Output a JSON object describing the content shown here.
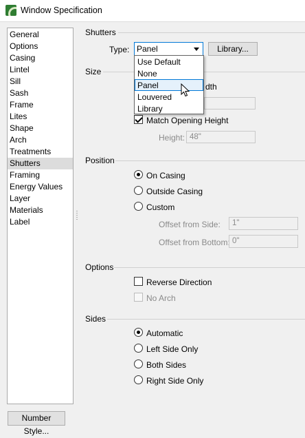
{
  "window": {
    "title": "Window Specification"
  },
  "nav": {
    "items": [
      "General",
      "Options",
      "Casing",
      "Lintel",
      "Sill",
      "Sash",
      "Frame",
      "Lites",
      "Shape",
      "Arch",
      "Treatments",
      "Shutters",
      "Framing",
      "Energy Values",
      "Layer",
      "Materials",
      "Label"
    ],
    "selected": "Shutters"
  },
  "shutters": {
    "group_label": "Shutters",
    "type_label": "Type:",
    "type_value": "Panel",
    "library_button": "Library...",
    "dropdown_options": [
      "Use Default",
      "None",
      "Panel",
      "Louvered",
      "Library"
    ],
    "dropdown_highlight": "Panel"
  },
  "size": {
    "group_label": "Size",
    "width_label_fragment": "dth",
    "match_height_label": "Match Opening Height",
    "match_height_checked": true,
    "height_label": "Height:",
    "height_value": "48\""
  },
  "position": {
    "group_label": "Position",
    "options": [
      "On Casing",
      "Outside Casing",
      "Custom"
    ],
    "selected": "On Casing",
    "offset_side_label": "Offset from Side:",
    "offset_side_value": "1\"",
    "offset_bottom_label": "Offset from Bottom:",
    "offset_bottom_value": "0\""
  },
  "options": {
    "group_label": "Options",
    "reverse_direction_label": "Reverse Direction",
    "reverse_direction_checked": false,
    "no_arch_label": "No Arch",
    "no_arch_checked": false
  },
  "sides": {
    "group_label": "Sides",
    "options": [
      "Automatic",
      "Left Side Only",
      "Both Sides",
      "Right Side Only"
    ],
    "selected": "Automatic"
  },
  "footer": {
    "number_style_button": "Number Style..."
  },
  "icons": {
    "app": "chief-architect-logo-icon",
    "cursor": "mouse-pointer-icon",
    "combo_arrow": "chevron-down-icon"
  },
  "colors": {
    "focus_border": "#0078d7",
    "selection_bg": "#dcdcdc",
    "hover_bg": "#e5f1fb"
  }
}
